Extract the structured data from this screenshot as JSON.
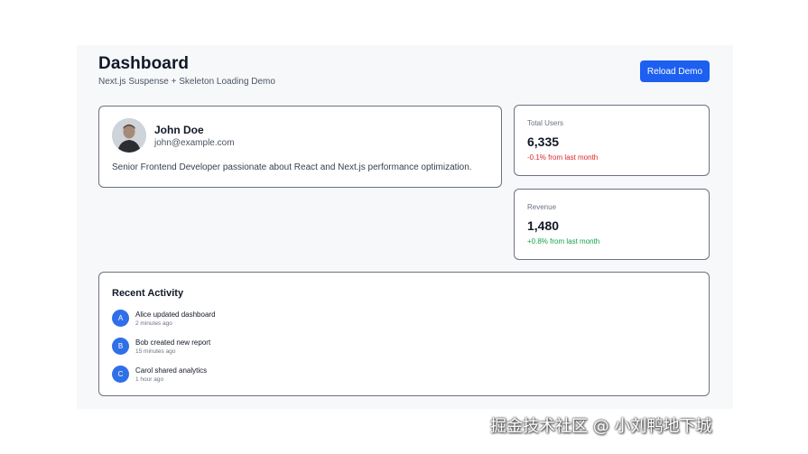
{
  "header": {
    "title": "Dashboard",
    "subtitle": "Next.js Suspense + Skeleton Loading Demo",
    "reload_label": "Reload Demo"
  },
  "profile": {
    "name": "John Doe",
    "email": "john@example.com",
    "bio": "Senior Frontend Developer passionate about React and Next.js performance optimization."
  },
  "stats": [
    {
      "label": "Total Users",
      "value": "6,335",
      "change": "-0.1% from last month",
      "trend": "negative"
    },
    {
      "label": "Revenue",
      "value": "1,480",
      "change": "+0.8% from last month",
      "trend": "positive"
    }
  ],
  "activity": {
    "title": "Recent Activity",
    "items": [
      {
        "initial": "A",
        "text": "Alice updated dashboard",
        "time": "2 minutes ago"
      },
      {
        "initial": "B",
        "text": "Bob created new report",
        "time": "15 minutes ago"
      },
      {
        "initial": "C",
        "text": "Carol shared analytics",
        "time": "1 hour ago"
      }
    ]
  },
  "colors": {
    "accent": "#1d5ff0",
    "avatar_circle": "#2f6fe8",
    "negative": "#dc2626",
    "positive": "#16a34a"
  },
  "watermark": "掘金技术社区 @ 小刘鸭地下城"
}
